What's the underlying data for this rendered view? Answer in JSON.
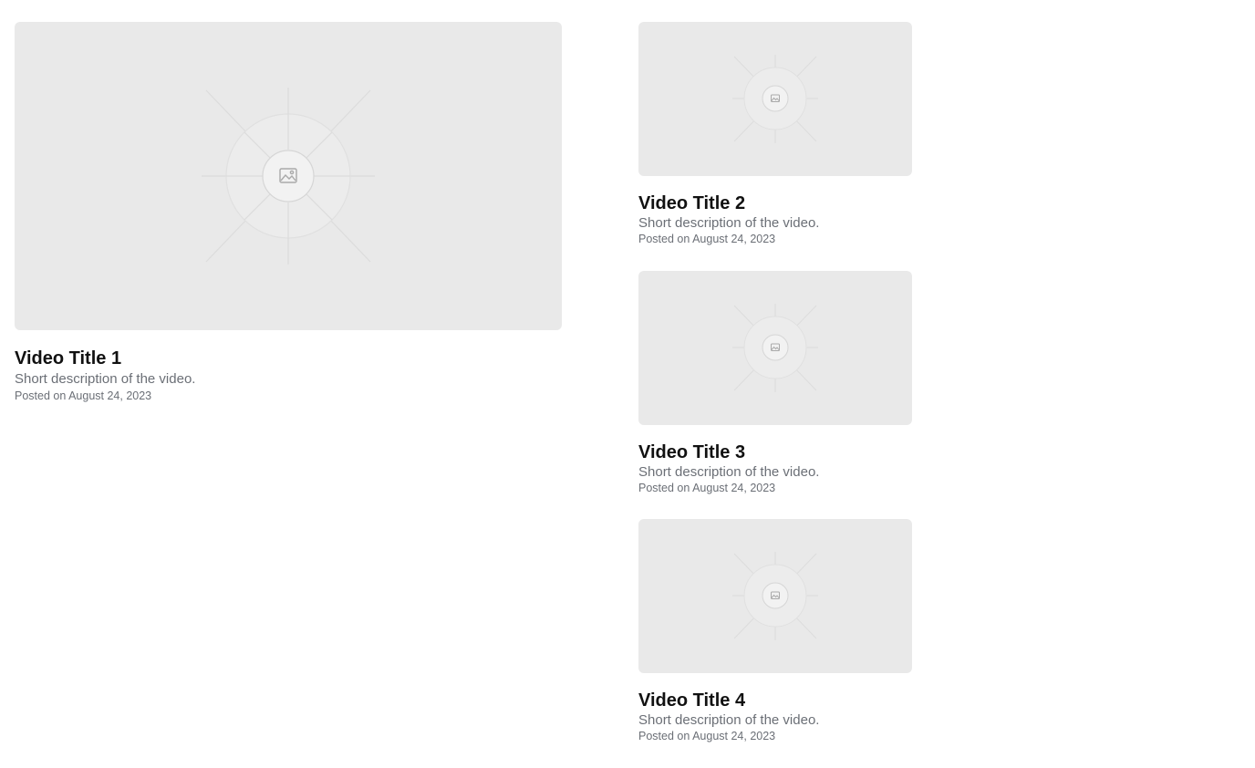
{
  "videos": [
    {
      "title": "Video Title 1",
      "description": "Short description of the video.",
      "posted": "Posted on August 24, 2023",
      "thumbnail_icon": "image-placeholder-icon"
    },
    {
      "title": "Video Title 2",
      "description": "Short description of the video.",
      "posted": "Posted on August 24, 2023",
      "thumbnail_icon": "image-placeholder-icon"
    },
    {
      "title": "Video Title 3",
      "description": "Short description of the video.",
      "posted": "Posted on August 24, 2023",
      "thumbnail_icon": "image-placeholder-icon"
    },
    {
      "title": "Video Title 4",
      "description": "Short description of the video.",
      "posted": "Posted on August 24, 2023",
      "thumbnail_icon": "image-placeholder-icon"
    }
  ],
  "colors": {
    "thumbnail_bg": "#e9e9e9",
    "title": "#111111",
    "muted_text": "#6b6f76"
  }
}
